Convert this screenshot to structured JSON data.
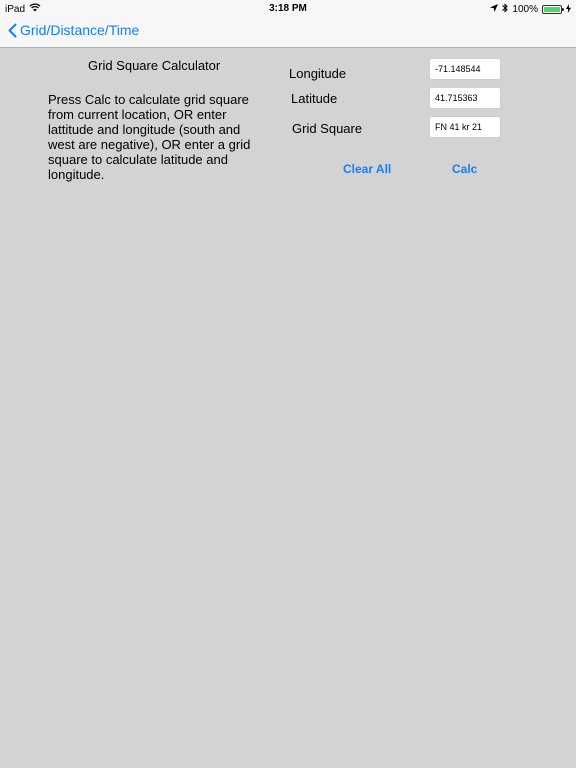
{
  "status_bar": {
    "device": "iPad",
    "time": "3:18 PM",
    "battery_text": "100%",
    "battery_level": 1.0
  },
  "nav": {
    "back_label": "Grid/Distance/Time"
  },
  "calculator": {
    "title": "Grid Square Calculator",
    "instructions": "Press Calc to calculate grid square from current location, OR enter lattitude and longitude (south and west are negative), OR enter a grid square to calculate latitude and longitude.",
    "longitude_label": "Longitude",
    "longitude_value": "-71.148544",
    "latitude_label": "Latitude",
    "latitude_value": "41.715363",
    "grid_label": "Grid Square",
    "grid_value": "FN 41 kr 21",
    "clear_label": "Clear All",
    "calc_label": "Calc"
  },
  "colors": {
    "accent": "#147efb",
    "background": "#d3d3d3",
    "bar": "#f7f7f7",
    "battery": "#4cd964"
  },
  "icons": [
    "wifi-icon",
    "location-arrow-icon",
    "bluetooth-icon",
    "battery-icon",
    "charging-bolt-icon",
    "chevron-left-icon"
  ]
}
